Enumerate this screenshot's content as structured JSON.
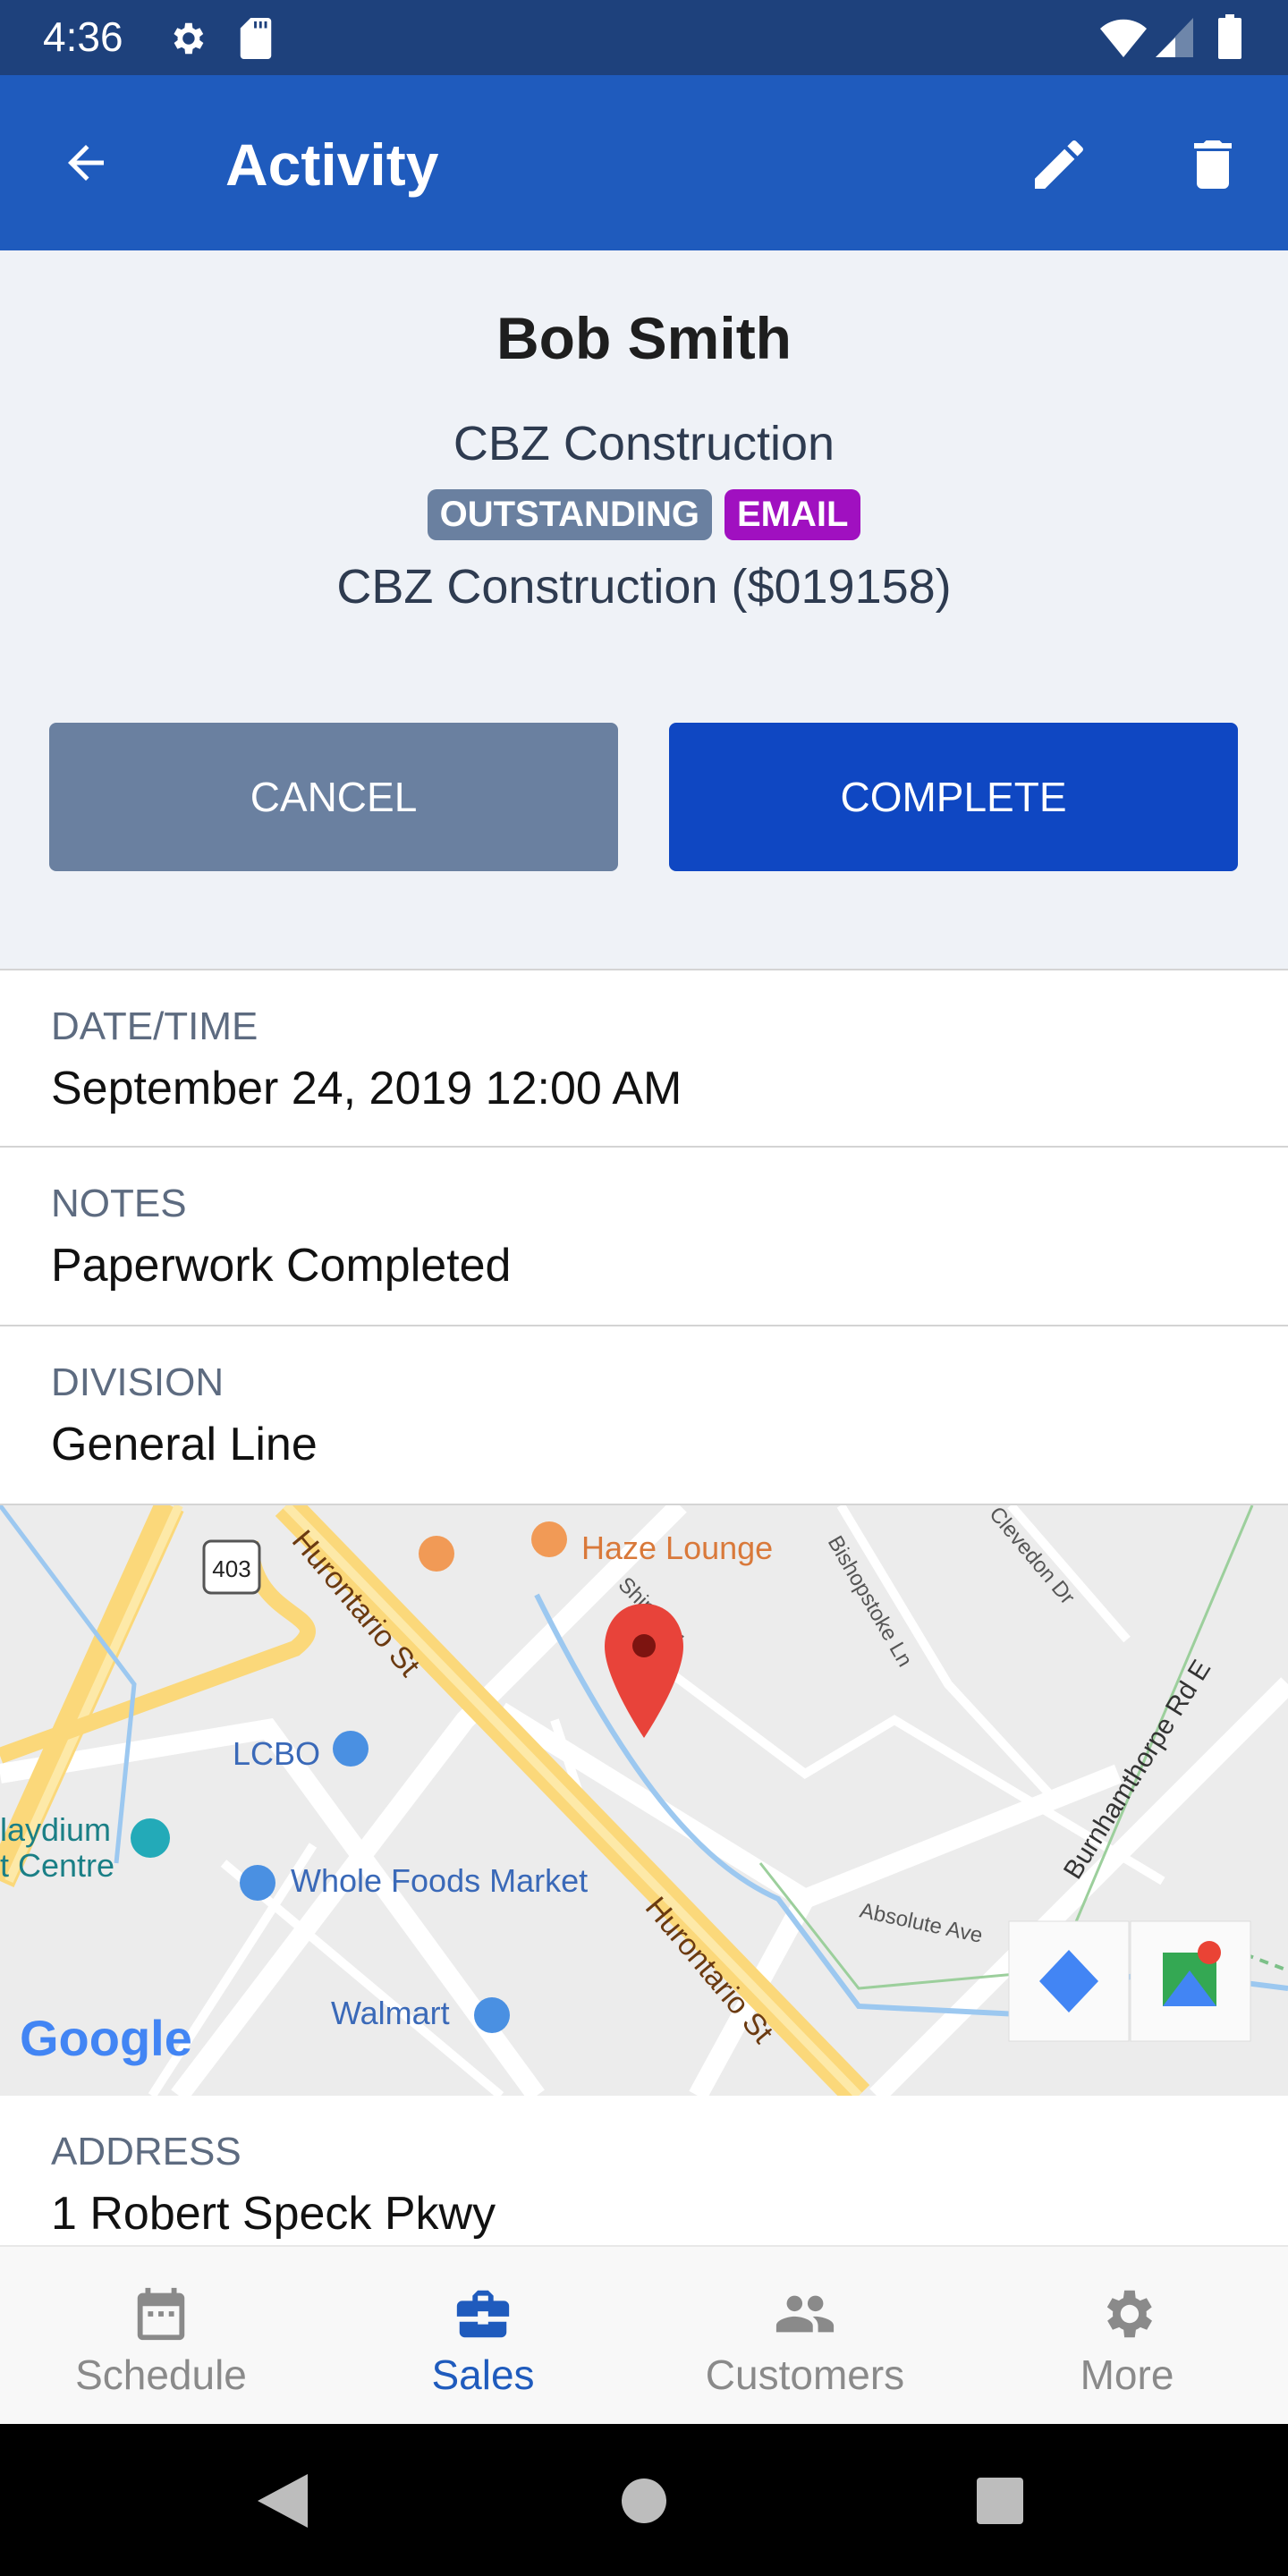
{
  "status_bar": {
    "time": "4:36",
    "icons": [
      "gear-icon",
      "sd-card-icon",
      "wifi-icon",
      "signal-icon",
      "battery-icon"
    ]
  },
  "app_bar": {
    "title": "Activity",
    "icons": [
      "back-arrow-icon",
      "edit-pencil-icon",
      "trash-icon"
    ]
  },
  "header": {
    "name": "Bob Smith",
    "company": "CBZ Construction",
    "badges": [
      {
        "label": "OUTSTANDING",
        "color": "#6a80a0"
      },
      {
        "label": "EMAIL",
        "color": "#a010c0"
      }
    ],
    "account": "CBZ Construction ($019158)"
  },
  "actions": {
    "cancel": "CANCEL",
    "complete": "COMPLETE",
    "cancel_color": "#6a80a0",
    "complete_color": "#0f47c2"
  },
  "fields": [
    {
      "label": "DATE/TIME",
      "value": "September 24, 2019 12:00 AM"
    },
    {
      "label": "NOTES",
      "value": "Paperwork Completed"
    },
    {
      "label": "DIVISION",
      "value": "General Line"
    }
  ],
  "map": {
    "labels": {
      "haze": "Haze Lounge",
      "lcbo": "LCBO",
      "whole": "Whole Foods Market",
      "walmart": "Walmart",
      "hur1": "Hurontario St",
      "hur2": "Hurontario St",
      "shipp": "Shipp Dr",
      "bishop": "Bishopstoke Ln",
      "clev": "Clevedon Dr",
      "burn": "Burnhamthorpe Rd E",
      "absolute": "Absolute Ave",
      "playdium1": "laydium",
      "playdium2": "t Centre",
      "hwy": "403",
      "google": "Google"
    }
  },
  "address": {
    "label": "ADDRESS",
    "value": "1 Robert Speck Pkwy"
  },
  "bottom_nav": [
    {
      "label": "Schedule",
      "active": false
    },
    {
      "label": "Sales",
      "active": true
    },
    {
      "label": "Customers",
      "active": false
    },
    {
      "label": "More",
      "active": false
    }
  ]
}
